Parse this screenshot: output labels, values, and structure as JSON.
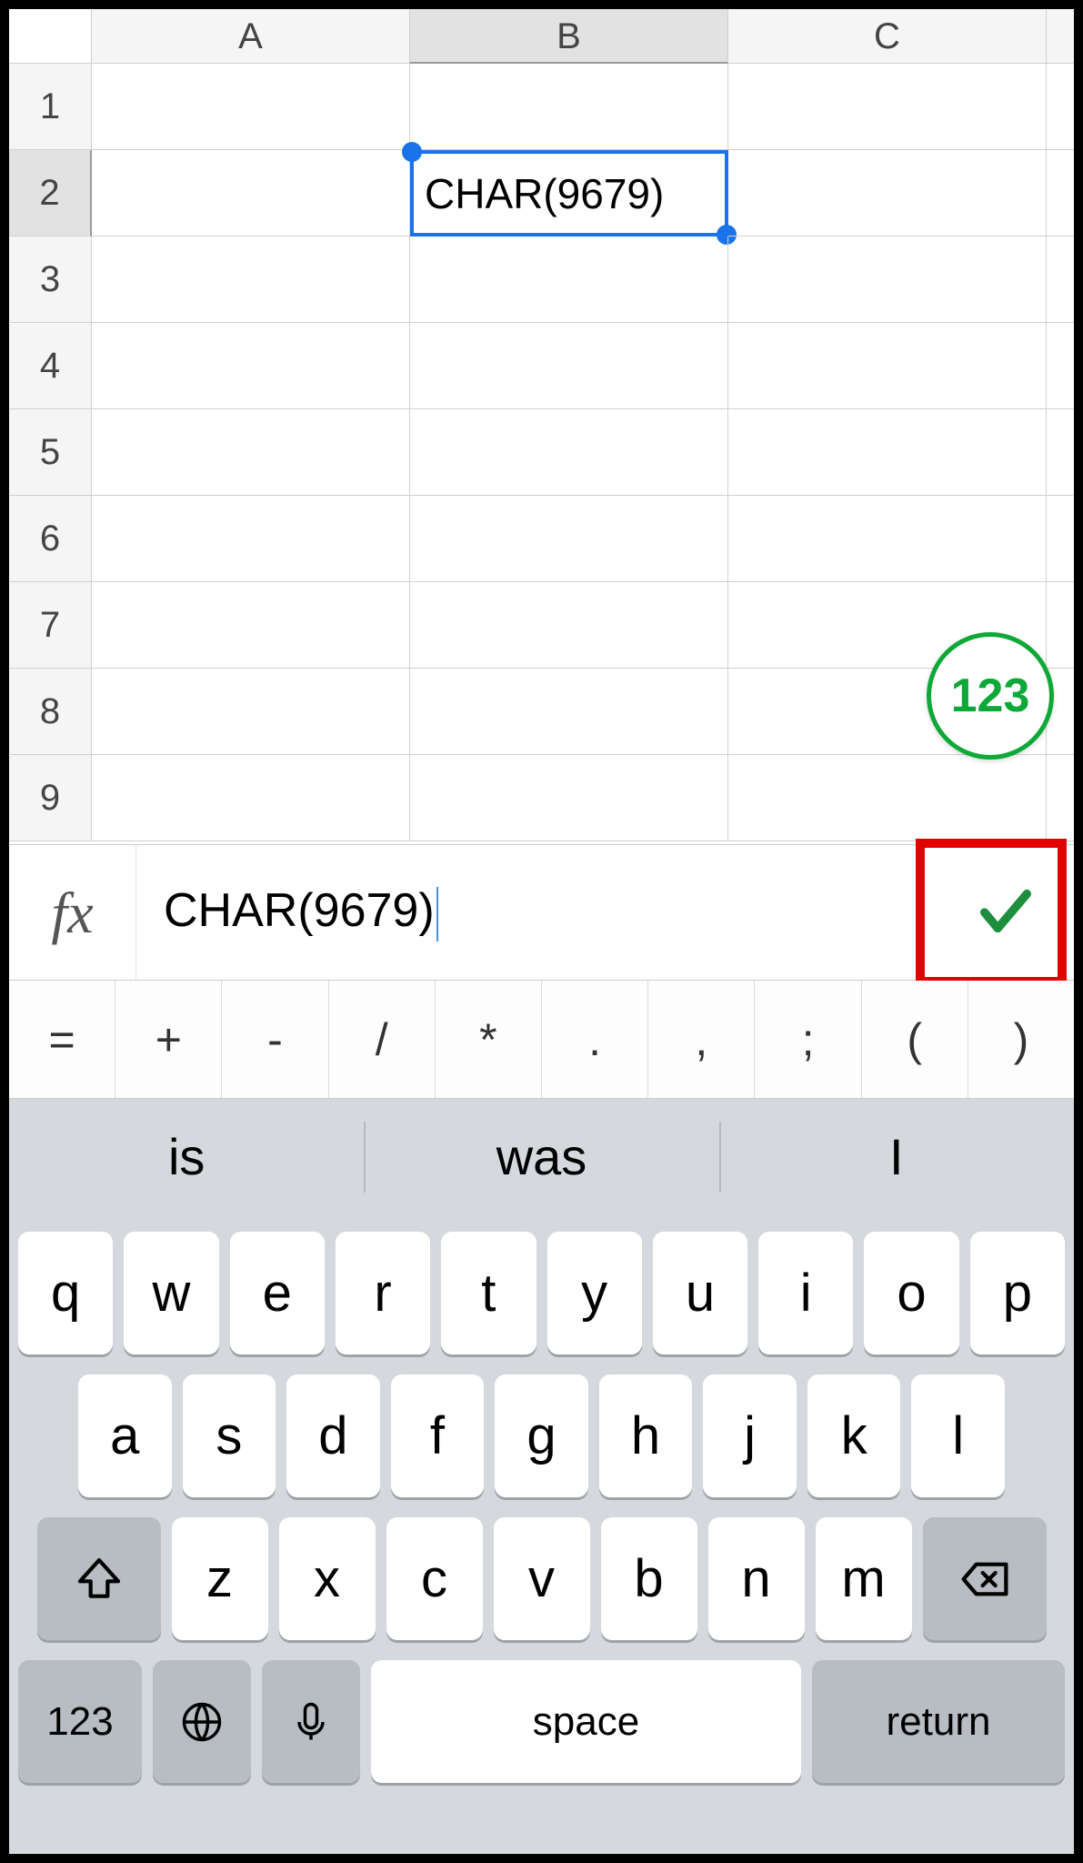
{
  "sheet": {
    "columns": [
      "A",
      "B",
      "C"
    ],
    "rows": [
      "1",
      "2",
      "3",
      "4",
      "5",
      "6",
      "7",
      "8",
      "9"
    ],
    "active_cell": {
      "row": 2,
      "col": "B",
      "value": "CHAR(9679)"
    }
  },
  "numpad_button": {
    "label": "123"
  },
  "formula_bar": {
    "fx_label": "fx",
    "value": "CHAR(9679)"
  },
  "symbol_row": [
    "=",
    "+",
    "-",
    "/",
    "*",
    ".",
    ",",
    ";",
    "(",
    ")"
  ],
  "suggestions": [
    "is",
    "was",
    "I"
  ],
  "keyboard": {
    "row1": [
      "q",
      "w",
      "e",
      "r",
      "t",
      "y",
      "u",
      "i",
      "o",
      "p"
    ],
    "row2": [
      "a",
      "s",
      "d",
      "f",
      "g",
      "h",
      "j",
      "k",
      "l"
    ],
    "row3": [
      "z",
      "x",
      "c",
      "v",
      "b",
      "n",
      "m"
    ],
    "num_key": "123",
    "space_key": "space",
    "return_key": "return"
  }
}
